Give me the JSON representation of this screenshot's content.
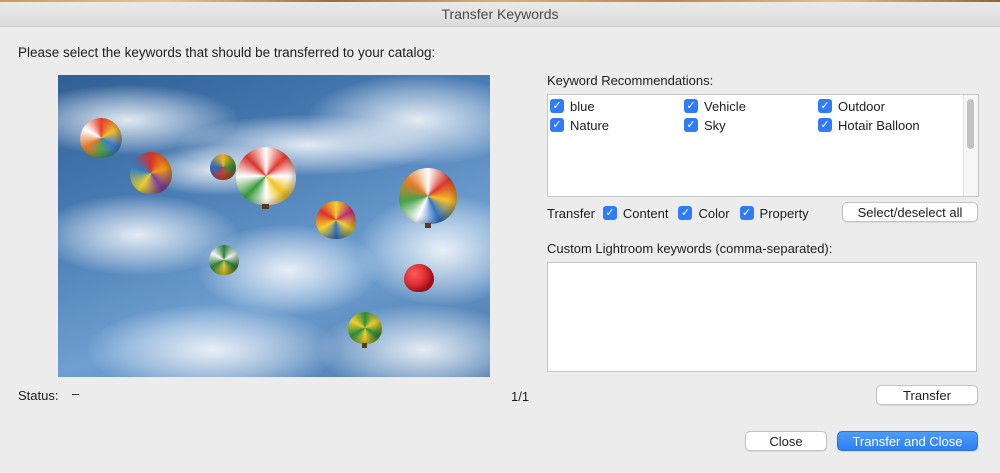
{
  "window": {
    "title": "Transfer Keywords"
  },
  "prompt": "Please select the keywords that should be transferred to your catalog:",
  "status": {
    "label": "Status:",
    "value": "–"
  },
  "counter": "1/1",
  "recommendations": {
    "label": "Keyword Recommendations:",
    "keywords": [
      {
        "label": "blue",
        "checked": true
      },
      {
        "label": "Vehicle",
        "checked": true
      },
      {
        "label": "Outdoor",
        "checked": true
      },
      {
        "label": "Nature",
        "checked": true
      },
      {
        "label": "Sky",
        "checked": true
      },
      {
        "label": "Hotair Balloon",
        "checked": true
      }
    ]
  },
  "transfer_options": {
    "label": "Transfer",
    "content": {
      "label": "Content",
      "checked": true
    },
    "color": {
      "label": "Color",
      "checked": true
    },
    "property": {
      "label": "Property",
      "checked": true
    }
  },
  "buttons": {
    "select_deselect": "Select/deselect all",
    "transfer": "Transfer",
    "close": "Close",
    "transfer_close": "Transfer and Close"
  },
  "custom": {
    "label": "Custom Lightroom keywords (comma-separated):",
    "value": ""
  },
  "icons": {
    "checkmark": "checkmark-icon"
  },
  "colors": {
    "accent": "#2f7cf6",
    "primary_button": "#3a8bf5",
    "sky": "#4b7db5"
  }
}
